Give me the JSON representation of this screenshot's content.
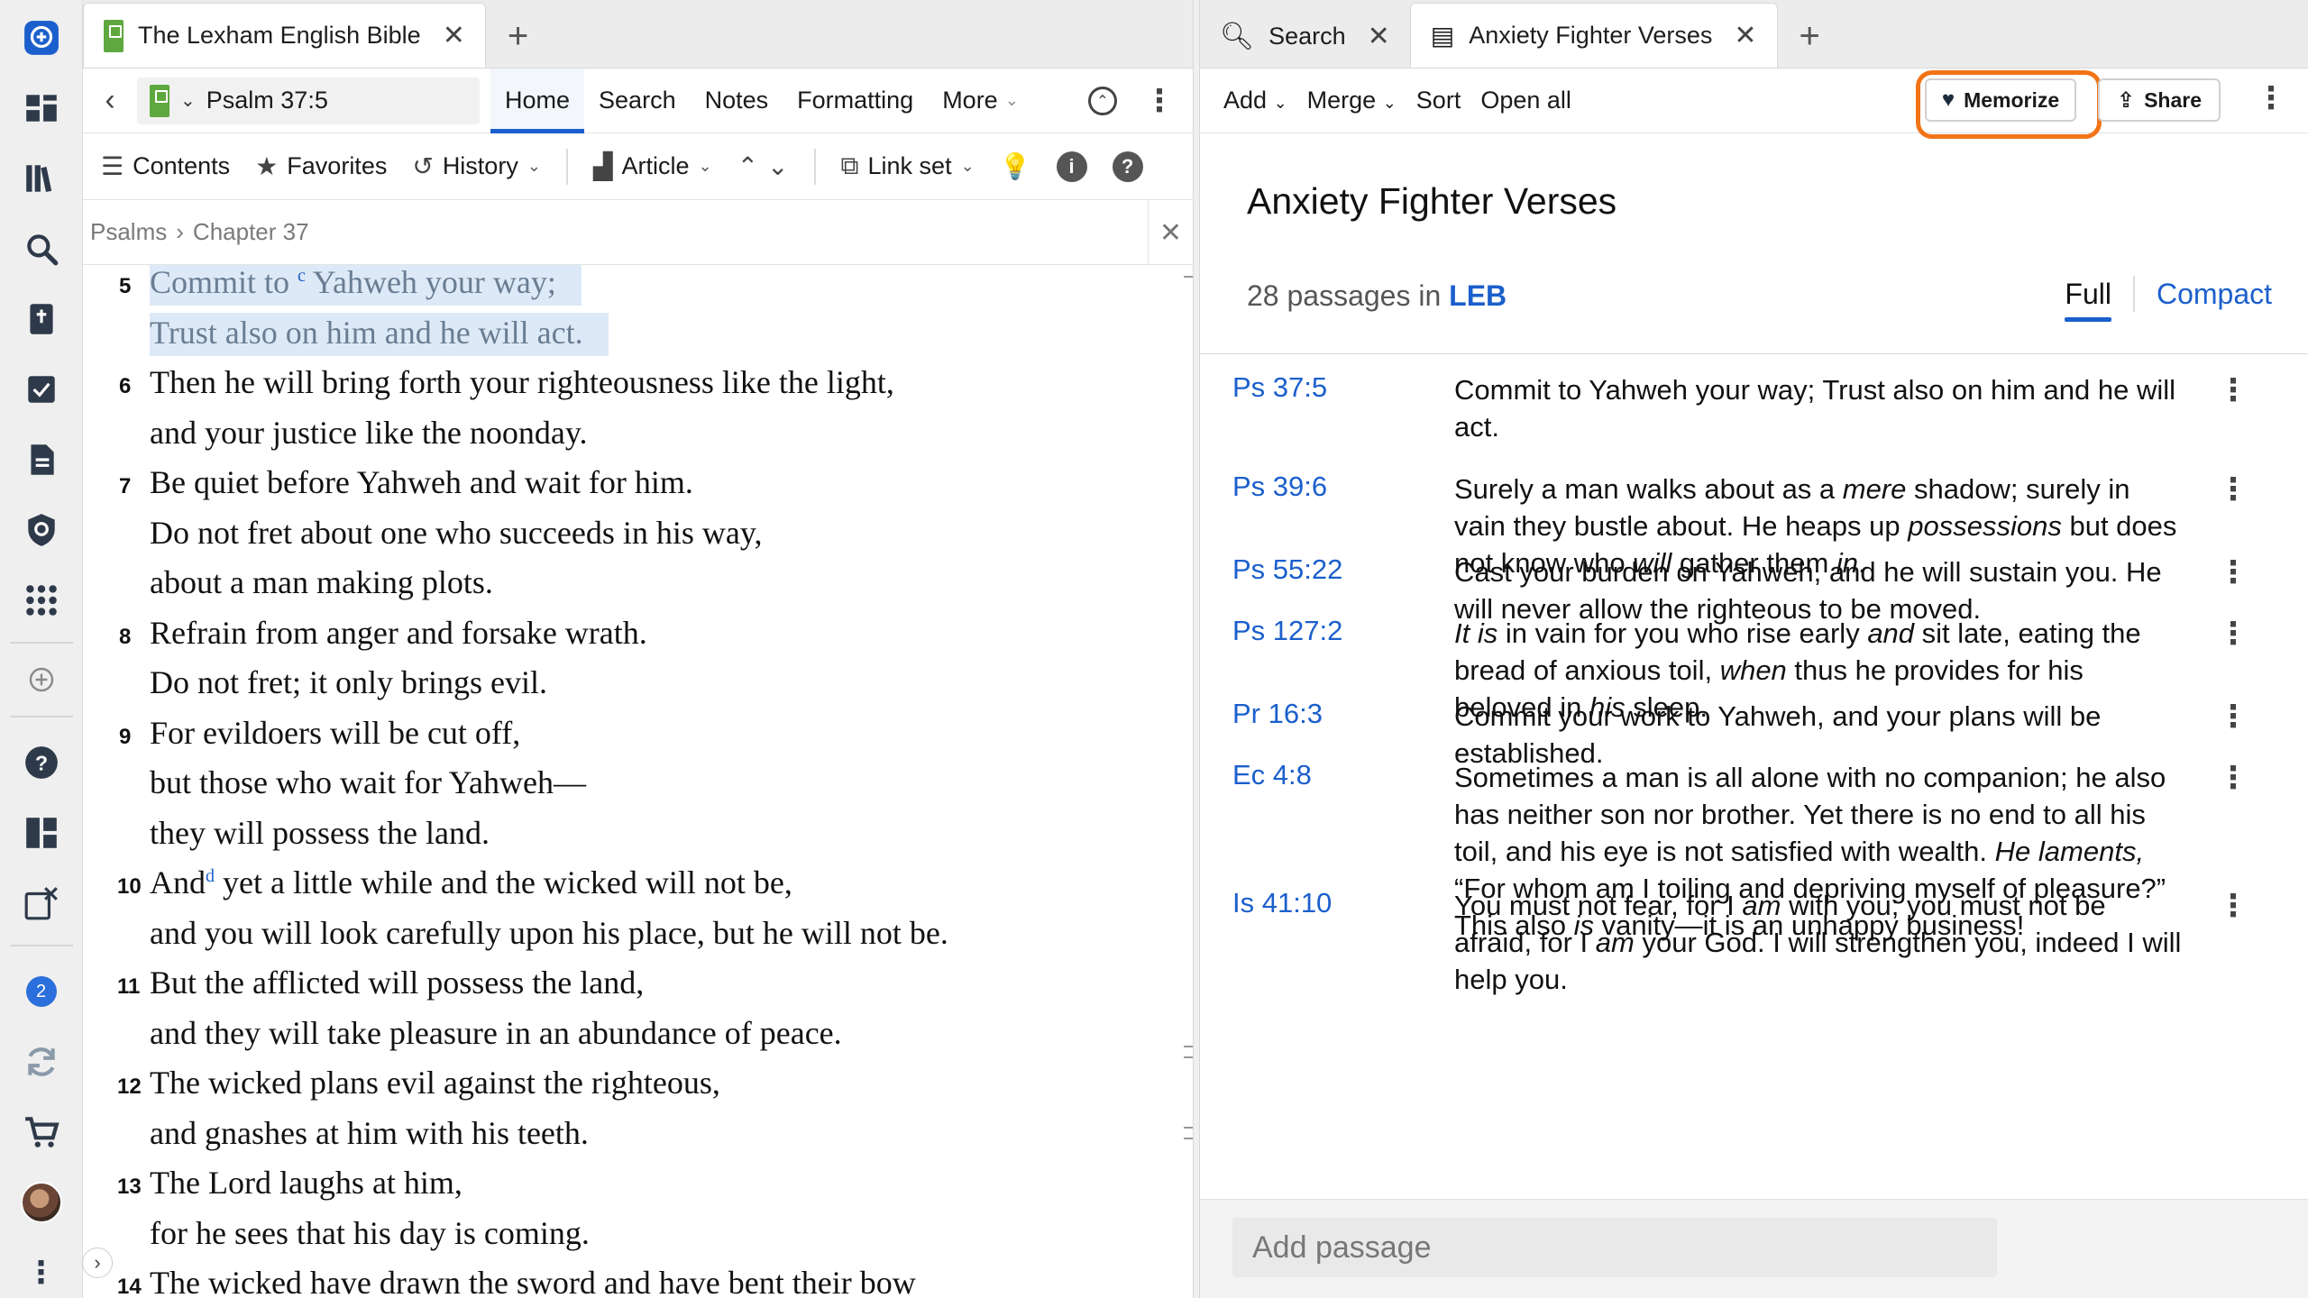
{
  "left_tabs": {
    "active_title": "The Lexham English Bible",
    "close": "✕",
    "add": "+"
  },
  "left_toolbar": {
    "reference": "Psalm 37:5",
    "tabs": [
      "Home",
      "Search",
      "Notes",
      "Formatting",
      "More"
    ],
    "row2": {
      "contents": "Contents",
      "favorites": "Favorites",
      "history": "History",
      "article": "Article",
      "link_set": "Link set"
    }
  },
  "breadcrumb": {
    "book": "Psalms",
    "sep": "›",
    "chapter": "Chapter 37",
    "close": "✕"
  },
  "bible_lines": [
    {
      "num": "5",
      "pre": "",
      "text": "Commit to ",
      "sup": "c",
      "post": "Yahweh your way;",
      "hl": true
    },
    {
      "num": "",
      "text": "Trust also on him and he will act.",
      "hl": true
    },
    {
      "num": "6",
      "text": "Then he will bring forth your righteousness like the light,"
    },
    {
      "num": "",
      "text": "and your justice like the noonday."
    },
    {
      "num": "7",
      "text": "Be quiet before Yahweh and wait for him."
    },
    {
      "num": "",
      "text": "Do not fret about one who succeeds in his way,"
    },
    {
      "num": "",
      "text": "about a man making plots."
    },
    {
      "num": "8",
      "text": "Refrain from anger and forsake wrath."
    },
    {
      "num": "",
      "text": "Do not fret; it only brings evil."
    },
    {
      "num": "9",
      "text": "For evildoers will be cut off,"
    },
    {
      "num": "",
      "text": "but those who wait for Yahweh—"
    },
    {
      "num": "",
      "text": "they will possess the land."
    },
    {
      "num": "10",
      "text": "And",
      "sup": "d",
      "post": " yet a little while and the wicked will not be,"
    },
    {
      "num": "",
      "text": "and you will look carefully upon his place, but he will not be."
    },
    {
      "num": "11",
      "text": "But the afflicted will possess the land,"
    },
    {
      "num": "",
      "text": "and they will take pleasure in an abundance of peace."
    },
    {
      "num": "12",
      "text": "The wicked plans evil against the righteous,"
    },
    {
      "num": "",
      "text": "and gnashes at him with his teeth."
    },
    {
      "num": "13",
      "text": "The Lord laughs at him,"
    },
    {
      "num": "",
      "text": "for he sees that his day is coming."
    },
    {
      "num": "14",
      "text": "The wicked have drawn the sword and have bent their bow"
    }
  ],
  "right_tabs": {
    "search_tab": "Search",
    "list_tab": "Anxiety Fighter Verses",
    "close": "✕",
    "add": "+"
  },
  "right_toolbar": {
    "add": "Add",
    "merge": "Merge",
    "sort": "Sort",
    "open_all": "Open all",
    "memorize": "Memorize",
    "share": "Share"
  },
  "passage_list": {
    "title": "Anxiety Fighter Verses",
    "meta_prefix": "28 passages in ",
    "version": "LEB",
    "view_full": "Full",
    "view_compact": "Compact",
    "add_placeholder": "Add passage",
    "items": [
      {
        "ref": "Ps 37:5",
        "html": "Commit to Yahweh your way; Trust also on him and he will act."
      },
      {
        "ref": "Ps 39:6",
        "html": "Surely a man walks about as a <i>mere</i> shadow; surely in vain they bustle about. He heaps up <i>possessions</i> but does not know who <i>will</i> gather them <i>in</i>."
      },
      {
        "ref": "Ps 55:22",
        "html": "Cast your burden on Yahweh, and he will sustain you. He will never allow the righteous to be moved."
      },
      {
        "ref": "Ps 127:2",
        "html": "<i>It is</i> in vain for you who rise early <i>and</i> sit late, eating the bread of anxious toil, <i>when</i> thus he provides for his beloved in <i>his</i> sleep."
      },
      {
        "ref": "Pr 16:3",
        "html": "Commit your work to Yahweh, and your plans will be established."
      },
      {
        "ref": "Ec 4:8",
        "html": "Sometimes a man is all alone with no companion; he also has neither son nor brother. Yet there is no end to all his toil, and his eye is not satisfied with wealth. <i>He laments,</i> “For whom am I toiling and depriving myself of pleasure?” This also <i>is</i> vanity—it is an unhappy business!"
      },
      {
        "ref": "Is 41:10",
        "html": "You must not fear, for I <i>am</i> with you; you must not be afraid, for I <i>am</i> your God. I will strengthen you, indeed I will help you."
      }
    ]
  },
  "appbar": {
    "notification_count": "2"
  },
  "colors": {
    "accent_blue": "#1b5fcc",
    "highlight_orange": "#f27417",
    "verse_highlight": "#dde9f7"
  }
}
